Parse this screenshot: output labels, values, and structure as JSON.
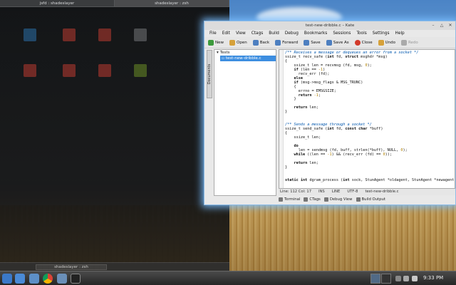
{
  "konsole": {
    "tab1": "jsfd : shadeslayer",
    "tab2": "shadeslayer : zsh",
    "bottom_tab": "shadeslayer : zsh"
  },
  "kate": {
    "title": "test-new-dribble.c – Kate",
    "menu": [
      "File",
      "Edit",
      "View",
      "Ctags",
      "Build",
      "Debug",
      "Bookmarks",
      "Sessions",
      "Tools",
      "Settings",
      "Help"
    ],
    "toolbar": [
      {
        "label": "New",
        "color": "#3c9a3c"
      },
      {
        "label": "Open",
        "color": "#d6a13a"
      },
      {
        "label": "Back",
        "color": "#4d7fc0"
      },
      {
        "label": "Forward",
        "color": "#4d7fc0"
      },
      {
        "label": "Save",
        "color": "#4d7fc0"
      },
      {
        "label": "Save As",
        "color": "#4d7fc0"
      },
      {
        "label": "Close",
        "color": "#d23a2a"
      },
      {
        "label": "Undo",
        "color": "#d6a13a"
      },
      {
        "label": "Redo",
        "color": "#aaaaaa"
      }
    ],
    "side_tab": "Documents",
    "tree": {
      "folder": "Tests",
      "file": "test-new-dribble.c"
    },
    "status": {
      "position": "Line: 112 Col: 17",
      "mode": "INS",
      "wrap": "LINE",
      "encoding": "UTF-8",
      "filename": "test-new-dribble.c"
    },
    "bottom_tabs": [
      "Terminal",
      "CTags",
      "Debug View",
      "Build Output"
    ]
  },
  "taskbar": {
    "clock": "9:33 PM",
    "icons": [
      "kde-menu-icon",
      "desktop-icon",
      "folder-icon",
      "chrome-icon",
      "kate-icon",
      "terminal-icon"
    ]
  },
  "colors": {
    "accent": "#3d8ee0",
    "glow": "#8fbde8"
  }
}
